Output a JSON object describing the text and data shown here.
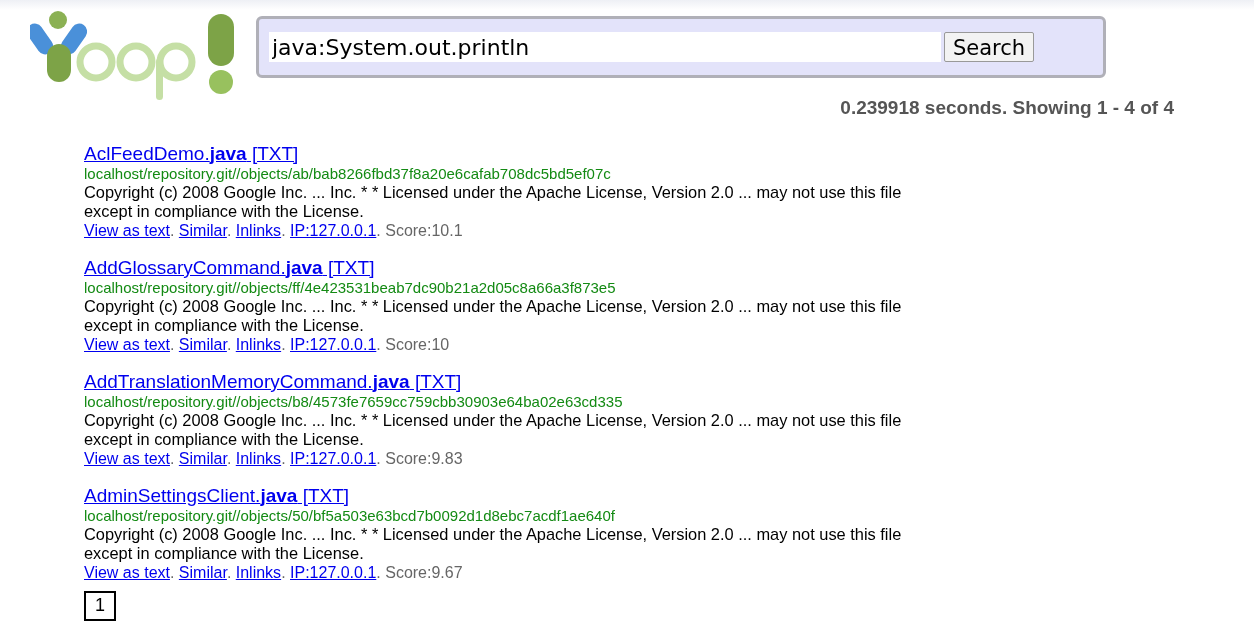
{
  "search": {
    "value": "java:System.out.println",
    "button": "Search"
  },
  "stats": "0.239918 seconds. Showing 1 - 4 of 4",
  "results": [
    {
      "title": "AclFeedDemo.**java** [TXT]",
      "url": "localhost/repository.git//objects/ab/bab8266fbd37f8a20e6cafab708dc5bd5ef07c",
      "snippet": "Copyright (c) 2008 Google Inc. ... Inc. * * Licensed under the Apache License, Version 2.0 ... may not use this file except in compliance with the License.",
      "actions": [
        "View as text",
        "Similar",
        "Inlinks",
        "IP:127.0.0.1"
      ],
      "score": "Score:10.1"
    },
    {
      "title": "AddGlossaryCommand.**java** [TXT]",
      "url": "localhost/repository.git//objects/ff/4e423531beab7dc90b21a2d05c8a66a3f873e5",
      "snippet": "Copyright (c) 2008 Google Inc. ... Inc. * * Licensed under the Apache License, Version 2.0 ... may not use this file except in compliance with the License.",
      "actions": [
        "View as text",
        "Similar",
        "Inlinks",
        "IP:127.0.0.1"
      ],
      "score": "Score:10"
    },
    {
      "title": "AddTranslationMemoryCommand.**java** [TXT]",
      "url": "localhost/repository.git//objects/b8/4573fe7659cc759cbb30903e64ba02e63cd335",
      "snippet": "Copyright (c) 2008 Google Inc. ... Inc. * * Licensed under the Apache License, Version 2.0 ... may not use this file except in compliance with the License.",
      "actions": [
        "View as text",
        "Similar",
        "Inlinks",
        "IP:127.0.0.1"
      ],
      "score": "Score:9.83"
    },
    {
      "title": "AdminSettingsClient.**java** [TXT]",
      "url": "localhost/repository.git//objects/50/bf5a503e63bcd7b0092d1d8ebc7acdf1ae640f",
      "snippet": "Copyright (c) 2008 Google Inc. ... Inc. * * Licensed under the Apache License, Version 2.0 ... may not use this file except in compliance with the License.",
      "actions": [
        "View as text",
        "Similar",
        "Inlinks",
        "IP:127.0.0.1"
      ],
      "score": "Score:9.67"
    }
  ],
  "separator": ".",
  "pages": [
    {
      "label": "1",
      "selected": true
    }
  ]
}
